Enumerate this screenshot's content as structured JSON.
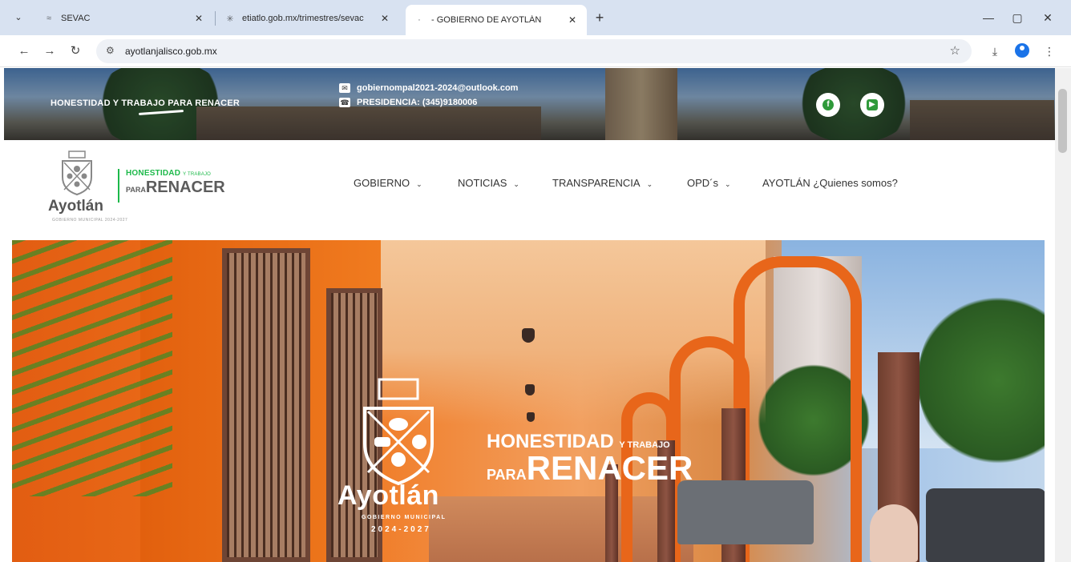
{
  "browser": {
    "tabs": [
      {
        "label": "SEVAC",
        "active": false
      },
      {
        "label": "etiatlo.gob.mx/trimestres/sevac",
        "active": false
      },
      {
        "label": "- GOBIERNO DE AYOTLÁN",
        "active": true
      }
    ],
    "url": "ayotlanjalisco.gob.mx",
    "new_tab_symbol": "+",
    "window_controls": {
      "minimize": "—",
      "maximize": "▢",
      "close": "✕"
    }
  },
  "topbar": {
    "slogan": "HONESTIDAD Y TRABAJO PARA RENACER",
    "email": "gobiernompal2021-2024@outlook.com",
    "phone": "PRESIDENCIA: (345)9180006",
    "social_icons": [
      "facebook-icon",
      "youtube-icon"
    ]
  },
  "header": {
    "logo_name": "Ayotlán",
    "logo_sub": "GOBIERNO MUNICIPAL 2024-2027",
    "brand_top": "HONESTIDAD",
    "brand_top_small": "Y TRABAJO",
    "brand_bottom_small": "PARA",
    "brand_bottom": "RENACER",
    "nav": [
      {
        "label": "GOBIERNO",
        "dropdown": true
      },
      {
        "label": "NOTICIAS",
        "dropdown": true
      },
      {
        "label": "TRANSPARENCIA",
        "dropdown": true
      },
      {
        "label": "OPD´s",
        "dropdown": true
      },
      {
        "label": "AYOTLÁN ¿Quienes somos?",
        "dropdown": false
      }
    ]
  },
  "hero": {
    "name": "Ayotlán",
    "sub1": "GOBIERNO MUNICIPAL",
    "sub2": "2024-2027",
    "slogan_big1": "HONESTIDAD",
    "slogan_small1": "Y TRABAJO",
    "slogan_small2": "PARA",
    "slogan_big2": "RENACER"
  },
  "colors": {
    "accent_green": "#1db94a",
    "hero_orange": "#f0751c",
    "social_green": "#2f9a3a"
  }
}
